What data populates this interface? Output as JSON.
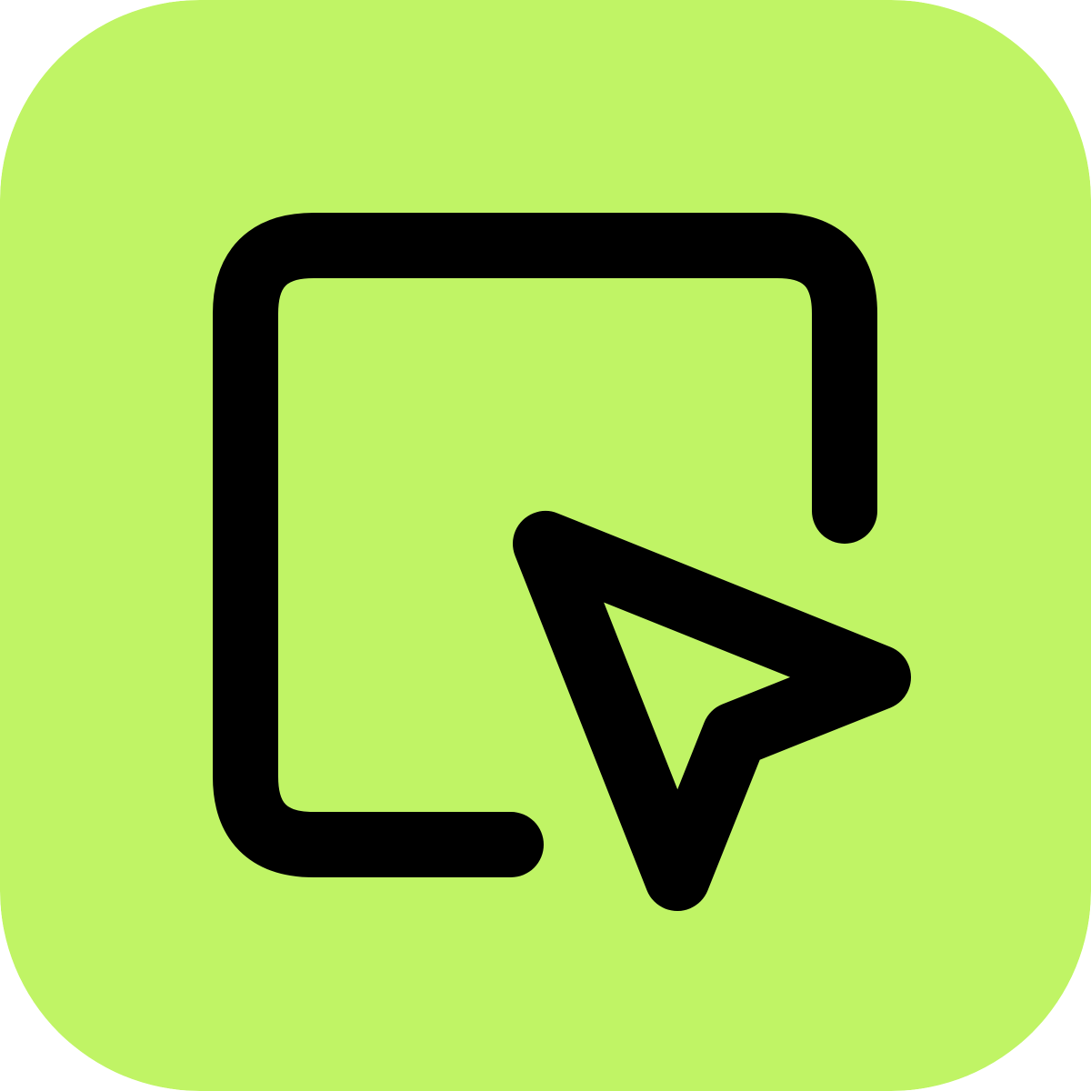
{
  "icon": {
    "name": "select-area-cursor-icon",
    "background_color": "#C0F465",
    "stroke_color": "#000000"
  }
}
